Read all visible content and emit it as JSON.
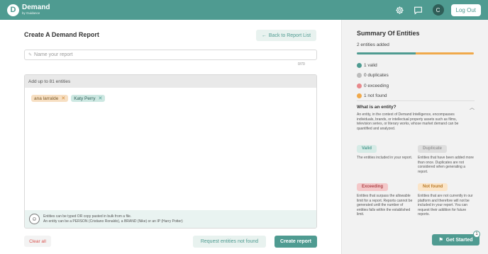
{
  "app": {
    "brand": "Demand",
    "brand_sub": "by Guidance",
    "logo_letter": "D",
    "accent": "#4f9b91"
  },
  "header": {
    "avatar_initial": "C",
    "logout_label": "Log Out"
  },
  "main": {
    "title": "Create A Demand Report",
    "back_label": "Back to Report List",
    "name_placeholder": "Name your report",
    "name_value": "",
    "name_counter": "0/70",
    "entities_header": "Add up to 81 entities",
    "chips": [
      {
        "label": "ana larralde",
        "status": "not-found"
      },
      {
        "label": "Katy Perry",
        "status": "valid"
      }
    ],
    "help_line1": "Entities can be typed OR copy pasted in bulk from a file.",
    "help_line2": "An entity can be a PERSON (Cristiano Ronaldo), a BRAND (Nike) or an IP (Harry Potter)",
    "clear_label": "Clear all",
    "request_label": "Request entities not found",
    "create_label": "Create report"
  },
  "summary": {
    "title": "Summary Of Entities",
    "count_text": "2 entities added",
    "progress": {
      "valid": 1,
      "not_found": 1,
      "total": 2
    },
    "legend": [
      {
        "label": "1 valid",
        "color": "#4f9b91"
      },
      {
        "label": "0 duplicates",
        "color": "#bdbdbd"
      },
      {
        "label": "0 exceeding",
        "color": "#e8898c"
      },
      {
        "label": "1 not found",
        "color": "#f0a94b"
      }
    ],
    "what_title": "What is an entity?",
    "what_desc": "An entity, in the context of Demand Intelligence, encompasses individuals, brands, or intellectual property assets such as films, television series, or literary works, whose market demand can be quantified and analyzed.",
    "types": {
      "valid": {
        "label": "Valid",
        "desc": "The entities included in your report."
      },
      "duplicate": {
        "label": "Duplicate",
        "desc": "Entities that have been added more than once. Duplicates are not considered when generating a report."
      },
      "exceeding": {
        "label": "Exceeding",
        "desc": "Entities that surpass the allowable limit for a report. Reports cannot be generated until the number of entities falls within the established limit."
      },
      "not_found": {
        "label": "Not found",
        "desc": "Entities that are not currently in our platform and therefore will not be included in your report. You can request their addition for future reports."
      }
    }
  },
  "get_started": {
    "label": "Get Started",
    "badge": "1"
  }
}
